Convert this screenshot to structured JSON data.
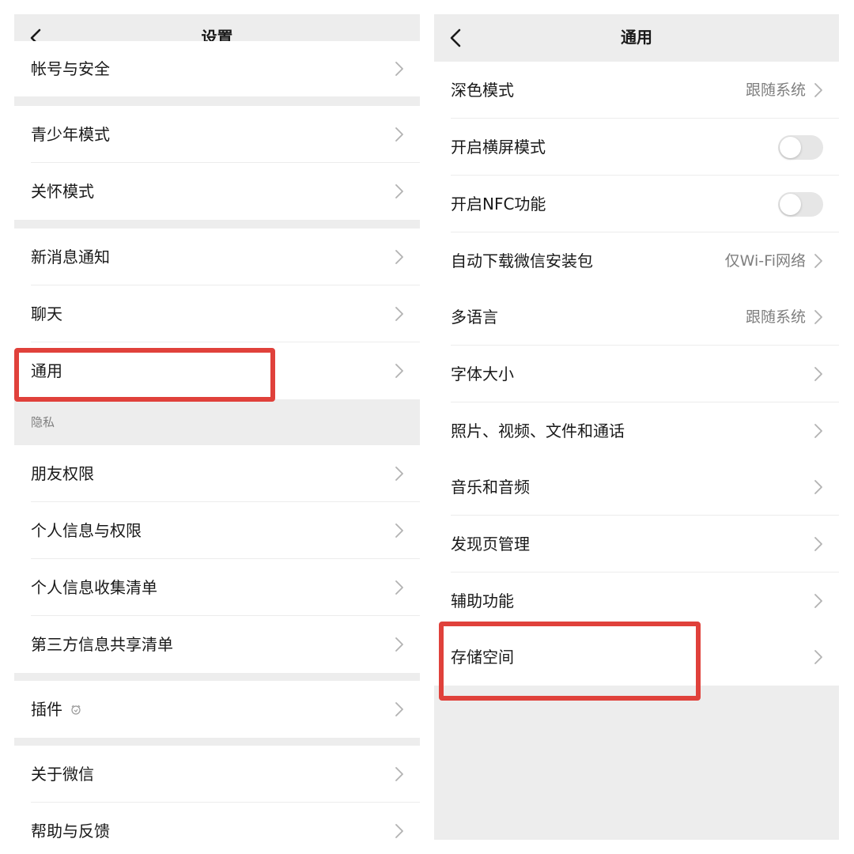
{
  "left": {
    "title": "设置",
    "items": {
      "account_security": "帐号与安全",
      "teen_mode": "青少年模式",
      "care_mode": "关怀模式",
      "notifications": "新消息通知",
      "chat": "聊天",
      "general": "通用",
      "privacy_header": "隐私",
      "friend_permissions": "朋友权限",
      "personal_info_permissions": "个人信息与权限",
      "personal_info_list": "个人信息收集清单",
      "third_party_list": "第三方信息共享清单",
      "plugins": "插件",
      "about": "关于微信",
      "help_feedback": "帮助与反馈"
    }
  },
  "right": {
    "title": "通用",
    "items": {
      "dark_mode": "深色模式",
      "dark_mode_value": "跟随系统",
      "landscape": "开启横屏模式",
      "landscape_on": false,
      "nfc": "开启NFC功能",
      "nfc_on": false,
      "auto_download": "自动下载微信安装包",
      "auto_download_value": "仅Wi-Fi网络",
      "language": "多语言",
      "language_value": "跟随系统",
      "font_size": "字体大小",
      "media": "照片、视频、文件和通话",
      "music_audio": "音乐和音频",
      "discover_manage": "发现页管理",
      "accessibility": "辅助功能",
      "storage": "存储空间"
    }
  },
  "colors": {
    "highlight_border": "#e0413b",
    "background": "#ededed",
    "row_background": "#ffffff"
  },
  "icons": {
    "back": "chevron-left-icon",
    "row_arrow": "chevron-right-icon",
    "plugin": "plugin-badge-icon"
  }
}
